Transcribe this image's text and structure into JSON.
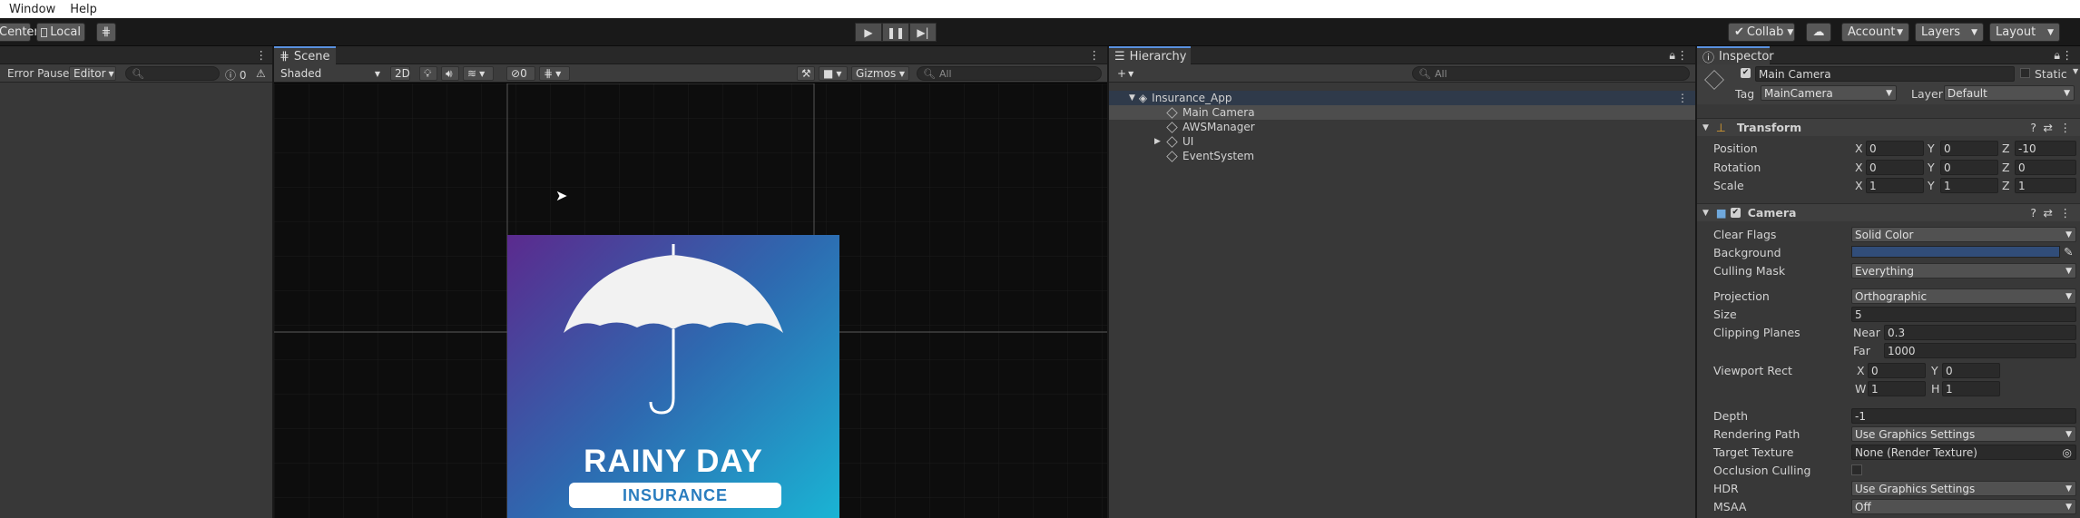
{
  "menu": {
    "window": "Window",
    "help": "Help"
  },
  "toolbar": {
    "pivot": "Center",
    "space": "Local",
    "collab": "Collab",
    "account": "Account",
    "layers": "Layers",
    "layout": "Layout"
  },
  "console": {
    "error_pause": "Error Pause",
    "editor": "Editor",
    "count": "0"
  },
  "scene": {
    "tab": "Scene",
    "shading": "Shaded",
    "mode_2d": "2D",
    "hidden_count": "0",
    "gizmos": "Gizmos",
    "search_placeholder": "All",
    "banner_title": "RAINY DAY",
    "banner_subtitle": "INSURANCE",
    "gradient_start": "#5b2a8e",
    "gradient_end": "#1ab4d4"
  },
  "hierarchy": {
    "tab": "Hierarchy",
    "search_placeholder": "All",
    "scene_name": "Insurance_App",
    "items": [
      {
        "label": "Main Camera"
      },
      {
        "label": "AWSManager"
      },
      {
        "label": "UI"
      },
      {
        "label": "EventSystem"
      }
    ]
  },
  "inspector": {
    "tab": "Inspector",
    "object_name": "Main Camera",
    "static_label": "Static",
    "tag_label": "Tag",
    "tag_value": "MainCamera",
    "layer_label": "Layer",
    "layer_value": "Default",
    "transform": {
      "title": "Transform",
      "position_label": "Position",
      "rotation_label": "Rotation",
      "scale_label": "Scale",
      "position": {
        "x": "0",
        "y": "0",
        "z": "-10"
      },
      "rotation": {
        "x": "0",
        "y": "0",
        "z": "0"
      },
      "scale": {
        "x": "1",
        "y": "1",
        "z": "1"
      }
    },
    "camera": {
      "title": "Camera",
      "clear_flags_label": "Clear Flags",
      "clear_flags": "Solid Color",
      "background_label": "Background",
      "background_color": "#314d79",
      "culling_mask_label": "Culling Mask",
      "culling_mask": "Everything",
      "projection_label": "Projection",
      "projection": "Orthographic",
      "size_label": "Size",
      "size": "5",
      "clipping_label": "Clipping Planes",
      "near_label": "Near",
      "near": "0.3",
      "far_label": "Far",
      "far": "1000",
      "viewport_label": "Viewport Rect",
      "vp_x": "0",
      "vp_y": "0",
      "vp_w": "1",
      "vp_h": "1",
      "depth_label": "Depth",
      "depth": "-1",
      "rendering_path_label": "Rendering Path",
      "rendering_path": "Use Graphics Settings",
      "target_texture_label": "Target Texture",
      "target_texture": "None (Render Texture)",
      "occlusion_label": "Occlusion Culling",
      "hdr_label": "HDR",
      "hdr": "Use Graphics Settings",
      "msaa_label": "MSAA",
      "msaa": "Off"
    }
  }
}
